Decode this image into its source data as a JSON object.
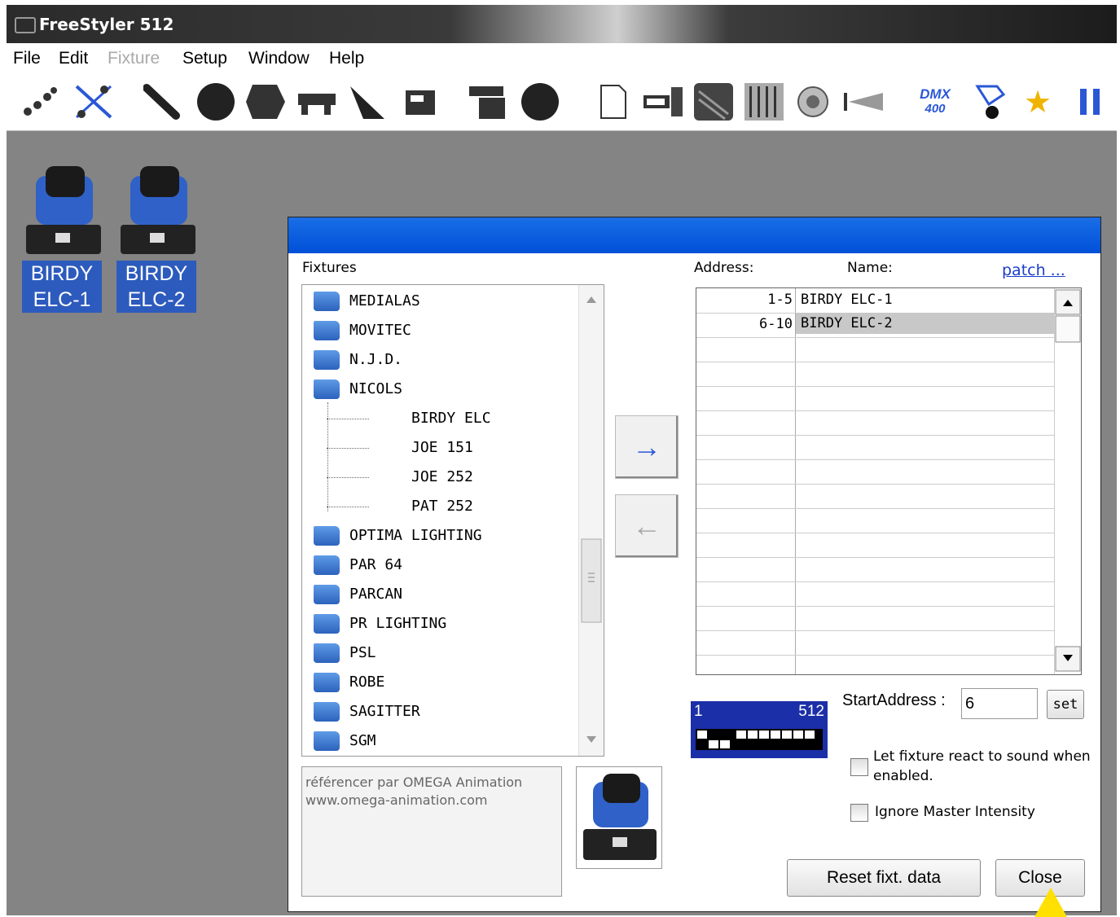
{
  "window": {
    "title": "FreeStyler 512"
  },
  "menu": [
    "File",
    "Edit",
    "Fixture",
    "Setup",
    "Window",
    "Help"
  ],
  "menu_disabled": [
    "Fixture"
  ],
  "toolbar": {
    "icons": [
      "scanners-icon",
      "scanners-cross-icon",
      "scanner-icon",
      "moving-head-icon",
      "gobo-icon",
      "shutter-icon",
      "light-bar-icon",
      "trim-icon",
      "cue-icon",
      "group-icon",
      "circle-icon",
      "new-page-icon",
      "cue-list-icon",
      "matrix-icon",
      "faders-icon",
      "sound-icon",
      "beam-icon",
      "dmx-400-icon",
      "sequence-icon",
      "favorites-icon",
      "pause-icon"
    ],
    "dmx_label": "DMX",
    "dmx_value": "400"
  },
  "workspace": {
    "fixtures": [
      {
        "label_line1": "BIRDY",
        "label_line2": "ELC-1"
      },
      {
        "label_line1": "BIRDY",
        "label_line2": "ELC-2"
      }
    ]
  },
  "dialog": {
    "fixtures_label": "Fixtures",
    "tree": [
      {
        "name": "MEDIALAS",
        "type": "folder"
      },
      {
        "name": "MOVITEC",
        "type": "folder"
      },
      {
        "name": "N.J.D.",
        "type": "folder"
      },
      {
        "name": "NICOLS",
        "type": "folder"
      },
      {
        "name": "BIRDY ELC",
        "type": "item"
      },
      {
        "name": "JOE 151",
        "type": "item"
      },
      {
        "name": "JOE 252",
        "type": "item"
      },
      {
        "name": "PAT 252",
        "type": "item"
      },
      {
        "name": "OPTIMA LIGHTING",
        "type": "folder"
      },
      {
        "name": "PAR 64",
        "type": "folder"
      },
      {
        "name": "PARCAN",
        "type": "folder"
      },
      {
        "name": "PR LIGHTING",
        "type": "folder"
      },
      {
        "name": "PSL",
        "type": "folder"
      },
      {
        "name": "ROBE",
        "type": "folder"
      },
      {
        "name": "SAGITTER",
        "type": "folder"
      },
      {
        "name": "SGM",
        "type": "folder"
      }
    ],
    "add_arrow": "→",
    "remove_arrow": "←",
    "description_line1": "référencer par OMEGA Animation",
    "description_line2": "www.omega-animation.com",
    "address_header": "Address:",
    "name_header": "Name:",
    "patch_link": "patch ...",
    "patched": [
      {
        "address": "1-5",
        "name": "BIRDY ELC-1"
      },
      {
        "address": "6-10",
        "name": "BIRDY ELC-2"
      }
    ],
    "dmx_map": {
      "start": "1",
      "end": "512"
    },
    "start_address_label": "StartAddress :",
    "start_address_value": "6",
    "set_button": "set",
    "sound_react_line1": "Let fixture react to sound when",
    "sound_react_line2": "enabled.",
    "ignore_master": "Ignore Master Intensity",
    "reset_button": "Reset fixt. data",
    "close_button": "Close",
    "colors": {
      "titlebar": "#0050d8",
      "selection": "#c8c8c8",
      "link": "#1a3ec8"
    }
  }
}
